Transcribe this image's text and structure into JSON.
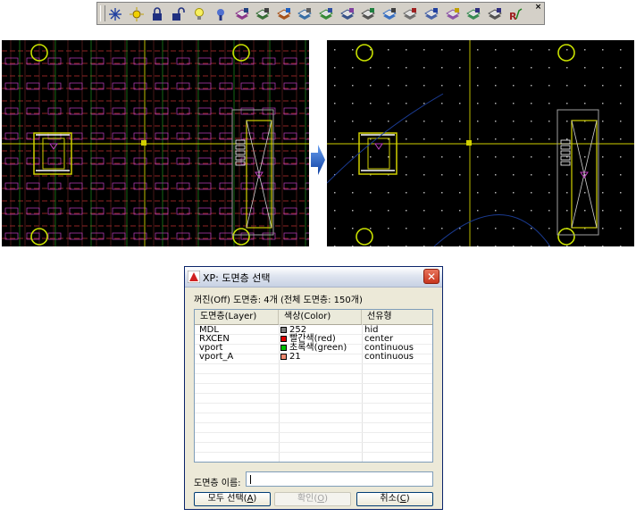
{
  "toolbar": {
    "close_glyph": "×",
    "buttons": [
      {
        "icon": "layer-off-icon"
      },
      {
        "icon": "layer-thaw-icon"
      },
      {
        "icon": "layer-lock-icon"
      },
      {
        "icon": "layer-unlock-icon"
      },
      {
        "icon": "layer-on-icon"
      },
      {
        "icon": "layer-isolate-icon"
      },
      {
        "icon": "layer-merge-icon"
      },
      {
        "icon": "layer-walk-icon"
      },
      {
        "icon": "layer-match-icon"
      },
      {
        "icon": "layer-previous-icon"
      },
      {
        "icon": "layer-change-icon"
      },
      {
        "icon": "layer-copy-icon"
      },
      {
        "icon": "layer-delete-icon"
      },
      {
        "icon": "layer-freeze-icon"
      },
      {
        "icon": "layer-state-icon"
      },
      {
        "icon": "layer-translate-icon"
      },
      {
        "icon": "layer-filter-icon"
      },
      {
        "icon": "layer-convert-icon"
      },
      {
        "icon": "layer-export-icon"
      },
      {
        "icon": "layer-rx-icon"
      }
    ]
  },
  "dialog": {
    "title": "XP: 도면층 선택",
    "summary": "꺼진(Off) 도면층: 4개 (전체 도면층: 150개)",
    "columns": [
      "도면층(Layer)",
      "색상(Color)",
      "선유형"
    ],
    "rows": [
      {
        "layer": "MDL",
        "color_name": "252",
        "swatch": "#808080",
        "linetype": "hid"
      },
      {
        "layer": "RXCEN",
        "color_name": "빨간색(red)",
        "swatch": "#e00000",
        "linetype": "center"
      },
      {
        "layer": "vport",
        "color_name": "초록색(green)",
        "swatch": "#00c000",
        "linetype": "continuous"
      },
      {
        "layer": "vport_A",
        "color_name": "21",
        "swatch": "#f08a70",
        "linetype": "continuous"
      }
    ],
    "name_label": "도면층 이름:",
    "name_value": "",
    "buttons": {
      "select_all": {
        "label": "모두 선택(",
        "key": "A",
        "tail": ")"
      },
      "ok": {
        "label": "확인(",
        "key": "O",
        "tail": ")"
      },
      "cancel": {
        "label": "취소(",
        "key": "C",
        "tail": ")"
      }
    }
  },
  "colors": {
    "cad_background": "#000000",
    "cad_lines_yellow": "#d0d000",
    "cad_lines_red": "#c03030",
    "cad_lines_magenta": "#c040c0",
    "cad_lines_green": "#20b020",
    "arrow_blue": "#1a58c8",
    "dialog_face": "#ece9d8"
  }
}
